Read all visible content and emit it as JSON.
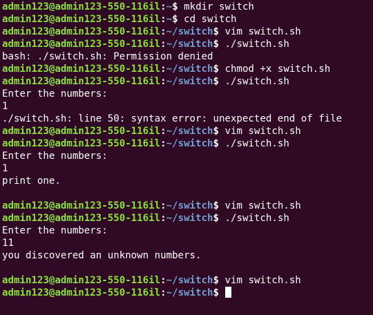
{
  "terminal": {
    "user_host": "admin123@admin123-550-116il",
    "prompt_colors": {
      "user_host": "#8ae234",
      "path": "#729fcf",
      "text": "#ffffff",
      "background": "#300a24"
    },
    "lines": [
      {
        "type": "prompt",
        "path": "~",
        "command": "mkdir switch"
      },
      {
        "type": "prompt",
        "path": "~",
        "command": "cd switch"
      },
      {
        "type": "prompt",
        "path": "~/switch",
        "command": "vim switch.sh"
      },
      {
        "type": "prompt",
        "path": "~/switch",
        "command": "./switch.sh"
      },
      {
        "type": "output",
        "text": "bash: ./switch.sh: Permission denied"
      },
      {
        "type": "prompt",
        "path": "~/switch",
        "command": "chmod +x switch.sh"
      },
      {
        "type": "prompt",
        "path": "~/switch",
        "command": "./switch.sh"
      },
      {
        "type": "output",
        "text": "Enter the numbers:"
      },
      {
        "type": "output",
        "text": "1"
      },
      {
        "type": "output",
        "text": "./switch.sh: line 50: syntax error: unexpected end of file"
      },
      {
        "type": "prompt",
        "path": "~/switch",
        "command": "vim switch.sh"
      },
      {
        "type": "prompt",
        "path": "~/switch",
        "command": "./switch.sh"
      },
      {
        "type": "output",
        "text": "Enter the numbers:"
      },
      {
        "type": "output",
        "text": "1"
      },
      {
        "type": "output",
        "text": "print one."
      },
      {
        "type": "output",
        "text": ""
      },
      {
        "type": "prompt",
        "path": "~/switch",
        "command": "vim switch.sh"
      },
      {
        "type": "prompt",
        "path": "~/switch",
        "command": "./switch.sh"
      },
      {
        "type": "output",
        "text": "Enter the numbers:"
      },
      {
        "type": "output",
        "text": "11"
      },
      {
        "type": "output",
        "text": "you discovered an unknown numbers."
      },
      {
        "type": "output",
        "text": ""
      },
      {
        "type": "prompt",
        "path": "~/switch",
        "command": "vim switch.sh"
      },
      {
        "type": "prompt",
        "path": "~/switch",
        "command": "",
        "cursor": true
      }
    ]
  }
}
